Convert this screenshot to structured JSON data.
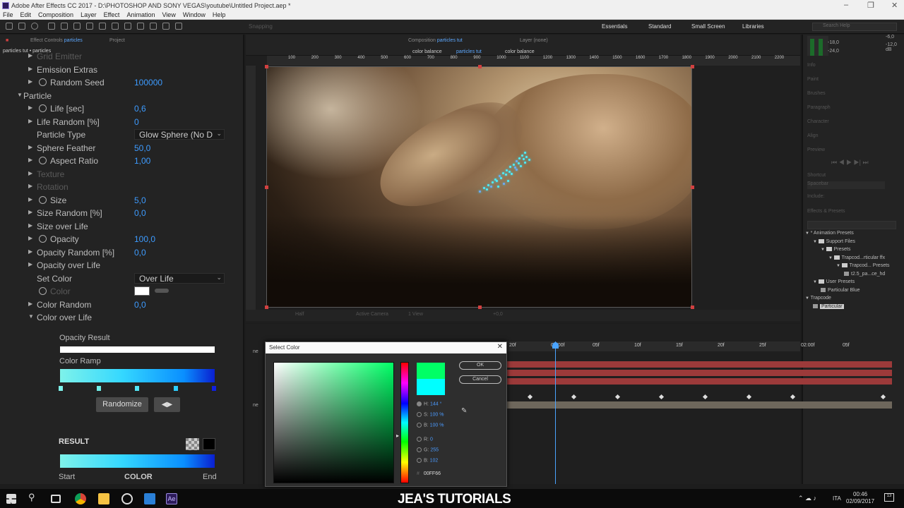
{
  "window": {
    "title": "Adobe After Effects CC 2017 - D:\\PHOTOSHOP AND SONY VEGAS\\youtube\\Untitled Project.aep *"
  },
  "menu": [
    "File",
    "Edit",
    "Composition",
    "Layer",
    "Effect",
    "Animation",
    "View",
    "Window",
    "Help"
  ],
  "toolbar": {
    "snapping": "Snapping",
    "workspaces": [
      "Essentials",
      "Standard",
      "Small Screen",
      "Libraries"
    ],
    "search_placeholder": "Search Help"
  },
  "effect_controls": {
    "tab_label": "Effect Controls",
    "tab_target": "particles",
    "project_tab": "Project",
    "breadcrumb": "particles tut • particles",
    "rows": [
      {
        "label": "Grid Emitter",
        "indent": 52,
        "dim": true,
        "tri": true
      },
      {
        "label": "Emission Extras",
        "indent": 52,
        "tri": true
      },
      {
        "label": "Random Seed",
        "indent": 71,
        "tri": true,
        "stopwatch": true,
        "value": "100000"
      },
      {
        "label": "Particle",
        "indent": 33,
        "tri": true,
        "open": true,
        "section": true
      },
      {
        "label": "Life [sec]",
        "indent": 71,
        "tri": true,
        "stopwatch": true,
        "value": "0,6"
      },
      {
        "label": "Life Random [%]",
        "indent": 52,
        "tri": true,
        "value": "0"
      },
      {
        "label": "Particle Type",
        "indent": 52,
        "dropdown": "Glow Sphere (No D"
      },
      {
        "label": "Sphere Feather",
        "indent": 52,
        "tri": true,
        "value": "50,0"
      },
      {
        "label": "Aspect Ratio",
        "indent": 71,
        "tri": true,
        "stopwatch": true,
        "value": "1,00"
      },
      {
        "label": "Texture",
        "indent": 52,
        "dim": true,
        "tri": true
      },
      {
        "label": "Rotation",
        "indent": 52,
        "dim": true,
        "tri": true
      },
      {
        "label": "Size",
        "indent": 71,
        "tri": true,
        "stopwatch": true,
        "value": "5,0"
      },
      {
        "label": "Size Random [%]",
        "indent": 52,
        "tri": true,
        "value": "0,0"
      },
      {
        "label": "Size over Life",
        "indent": 52,
        "tri": true
      },
      {
        "label": "Opacity",
        "indent": 71,
        "tri": true,
        "stopwatch": true,
        "value": "100,0"
      },
      {
        "label": "Opacity Random [%]",
        "indent": 52,
        "tri": true,
        "value": "0,0"
      },
      {
        "label": "Opacity over Life",
        "indent": 52,
        "tri": true
      },
      {
        "label": "Set Color",
        "indent": 52,
        "dropdown": "Over Life"
      },
      {
        "label": "Color",
        "indent": 71,
        "dim": true,
        "stopwatch": true,
        "swatch": true
      },
      {
        "label": "Color Random",
        "indent": 52,
        "tri": true,
        "value": "0,0"
      },
      {
        "label": "Color over Life",
        "indent": 52,
        "tri": true,
        "open": true
      }
    ],
    "opacity_result": "Opacity Result",
    "color_ramp": "Color Ramp",
    "randomize": "Randomize",
    "result": "RESULT",
    "start": "Start",
    "color": "COLOR",
    "end": "End"
  },
  "composition": {
    "tab_label": "Composition",
    "tab_target": "particles tut",
    "layer_tab": "Layer (none)",
    "breadcrumbs": [
      "color balance",
      "particles tut",
      "color balance"
    ],
    "ruler_labels": [
      "100",
      "200",
      "300",
      "400",
      "500",
      "600",
      "700",
      "800",
      "900",
      "1000",
      "1100",
      "1200",
      "1300",
      "1400",
      "1500",
      "1600",
      "1700",
      "1800",
      "1900",
      "2000",
      "2100",
      "2200"
    ],
    "zoom": "Half",
    "camera": "Active Camera",
    "views": "1 View",
    "exposure": "+0,0"
  },
  "right_panel": {
    "audio": [
      "-6,0",
      "-12,0 dB",
      "-18,0",
      "-24,0"
    ],
    "sections": [
      "Info",
      "Paint",
      "Brushes",
      "Paragraph",
      "Character",
      "Align",
      "Preview",
      "Shortcut",
      "Include:",
      "Effects & Presets"
    ],
    "shortcut": "Spacebar",
    "tree": [
      {
        "label": "* Animation Presets",
        "level": 0,
        "type": "tri"
      },
      {
        "label": "Support Files",
        "level": 1,
        "type": "folder"
      },
      {
        "label": "Presets",
        "level": 2,
        "type": "folder"
      },
      {
        "label": "Trapcod...rticular ffx",
        "level": 3,
        "type": "folder"
      },
      {
        "label": "Trapcod... Presets",
        "level": 4,
        "type": "folder"
      },
      {
        "label": "t2.5_pa...ce_hd",
        "level": 5,
        "type": "file"
      },
      {
        "label": "User Presets",
        "level": 1,
        "type": "folder"
      },
      {
        "label": "Particular Blue",
        "level": 2,
        "type": "file"
      },
      {
        "label": "Trapcode",
        "level": 0,
        "type": "tri"
      },
      {
        "label": "Particular",
        "level": 1,
        "type": "file",
        "selected": true
      }
    ]
  },
  "timeline": {
    "ruler": [
      "20f",
      "01:00f",
      "05f",
      "10f",
      "15f",
      "20f",
      "25f",
      "02:00f",
      "05f"
    ]
  },
  "color_dialog": {
    "title": "Select Color",
    "ok": "OK",
    "cancel": "Cancel",
    "h_label": "H:",
    "h_value": "144 °",
    "s_label": "S:",
    "s_value": "100 %",
    "b_label": "B:",
    "b_value": "100 %",
    "r_label": "R:",
    "r_value": "0",
    "g_label": "G:",
    "g_value": "255",
    "b2_label": "B:",
    "b2_value": "102",
    "hex_prefix": "#",
    "hex": "00FF66",
    "new_color": "#00ff66",
    "old_color": "#00ffff"
  },
  "taskbar": {
    "brand": "JEA'S TUTORIALS",
    "lang": "ITA",
    "time": "00:46",
    "date": "02/09/2017",
    "notif": "13"
  }
}
